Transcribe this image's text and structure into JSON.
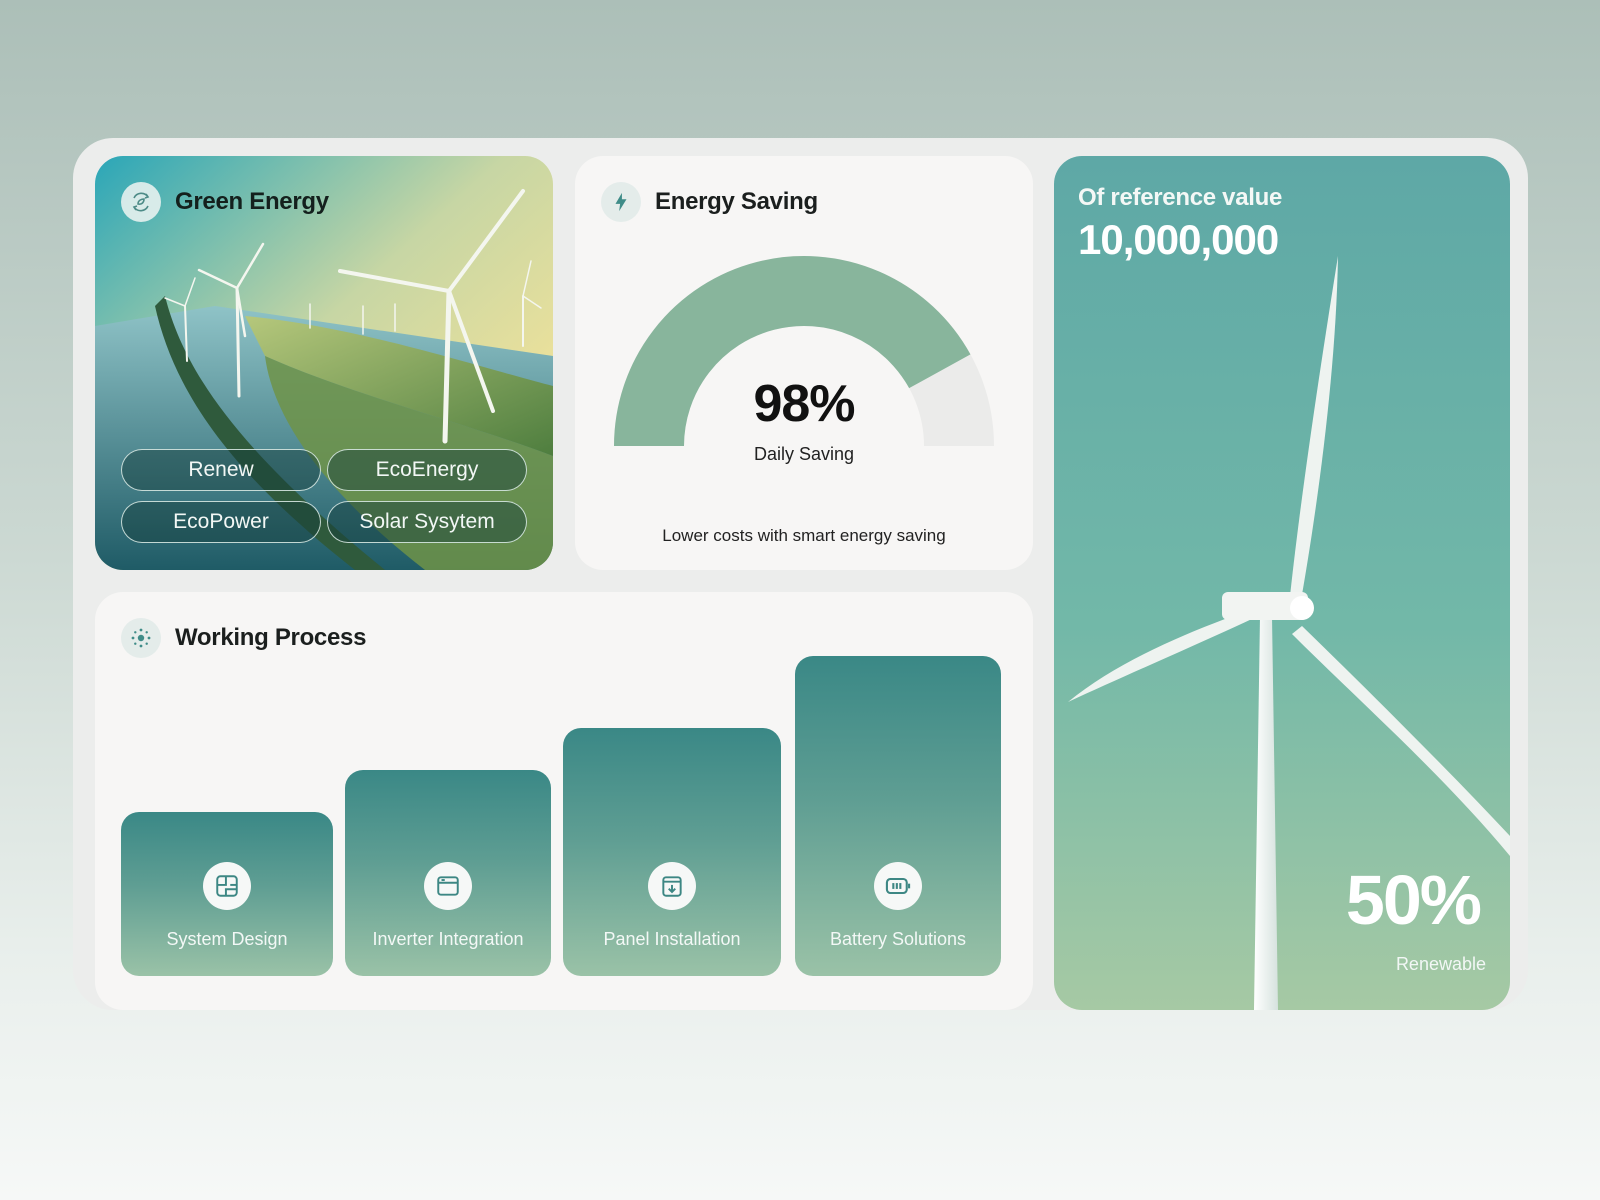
{
  "green_energy": {
    "title": "Green Energy",
    "icon": "eco-cycle-icon",
    "tags": [
      "Renew",
      "EcoEnergy",
      "EcoPower",
      "Solar Sysytem"
    ]
  },
  "energy_saving": {
    "title": "Energy Saving",
    "icon": "lightning-icon",
    "percent": 98,
    "percent_label": "98%",
    "subtitle": "Daily Saving",
    "caption": "Lower costs with smart energy saving",
    "gauge_color": "#88b59c",
    "track_color": "#ebebea"
  },
  "working_process": {
    "title": "Working Process",
    "icon": "network-icon",
    "steps": [
      {
        "label": "System Design",
        "icon": "blueprint-icon"
      },
      {
        "label": "Inverter Integration",
        "icon": "window-icon"
      },
      {
        "label": "Panel Installation",
        "icon": "download-box-icon"
      },
      {
        "label": "Battery Solutions",
        "icon": "battery-icon"
      }
    ]
  },
  "reference": {
    "label": "Of reference value",
    "value": "10,000,000",
    "percent": "50%",
    "percent_label": "Renewable"
  },
  "colors": {
    "accent_teal": "#3a8886",
    "accent_sage": "#9ac2a7"
  }
}
